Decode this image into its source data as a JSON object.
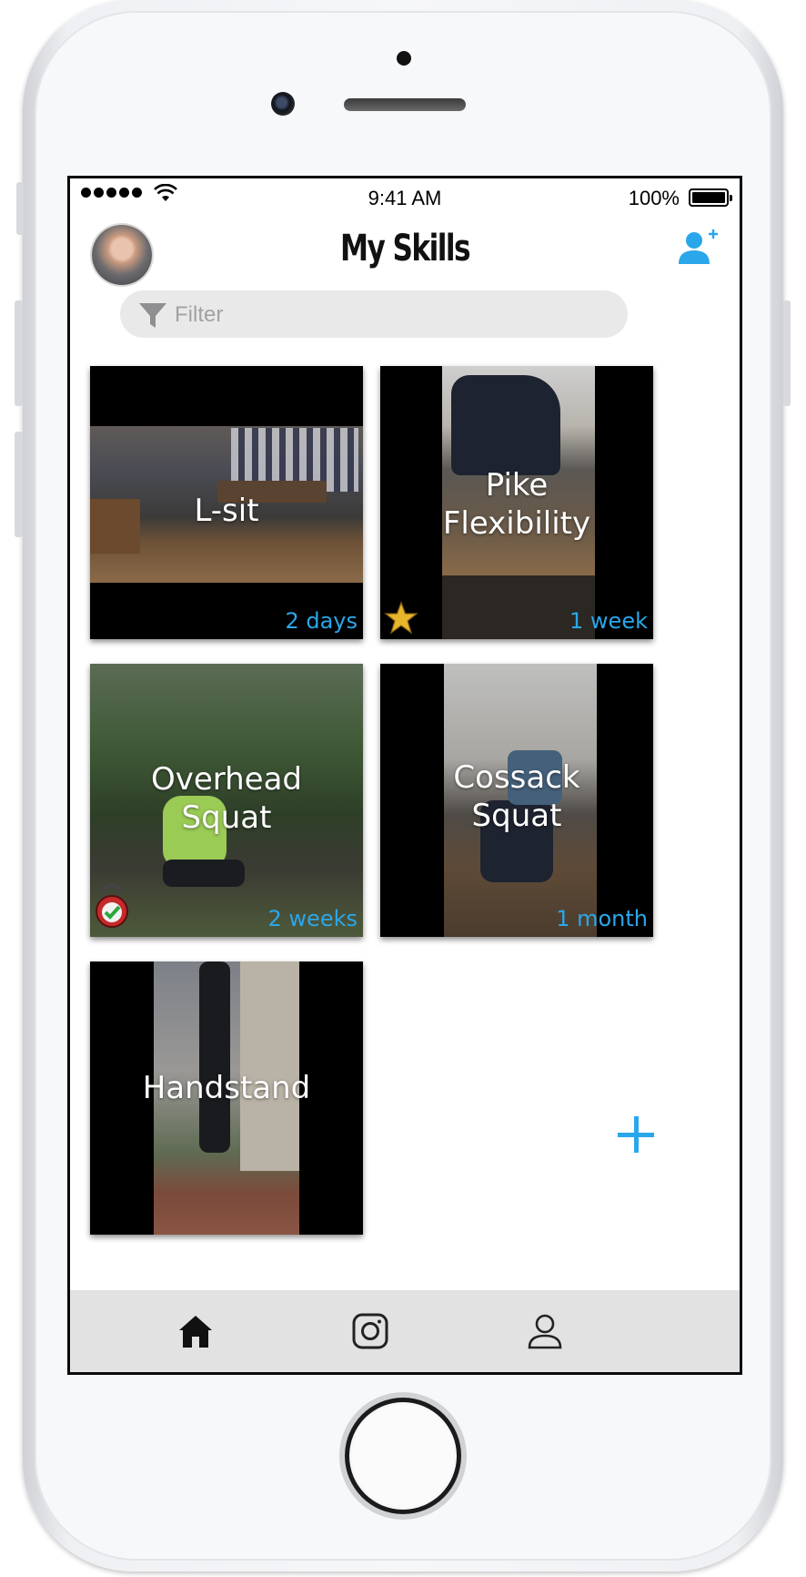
{
  "status_bar": {
    "time": "9:41 AM",
    "battery": "100%"
  },
  "header": {
    "title": "My Skills"
  },
  "filter": {
    "placeholder": "Filter"
  },
  "skills": [
    {
      "name": "L-sit",
      "time_ago": "2 days"
    },
    {
      "name": "Pike Flexibility",
      "time_ago": "1 week",
      "badge": "star-icon"
    },
    {
      "name": "Overhead Squat",
      "time_ago": "2 weeks",
      "badge": "kettlebell-check-icon"
    },
    {
      "name": "Cossack Squat",
      "time_ago": "1 month"
    },
    {
      "name": "Handstand",
      "time_ago": ""
    }
  ],
  "tabs": [
    {
      "icon": "home-icon",
      "active": true
    },
    {
      "icon": "instagram-icon",
      "active": false
    },
    {
      "icon": "profile-icon",
      "active": false
    }
  ],
  "colors": {
    "accent": "#2aa7ea",
    "tab_bar": "#e0e0e0",
    "filter_bg": "#e9e9ea"
  }
}
